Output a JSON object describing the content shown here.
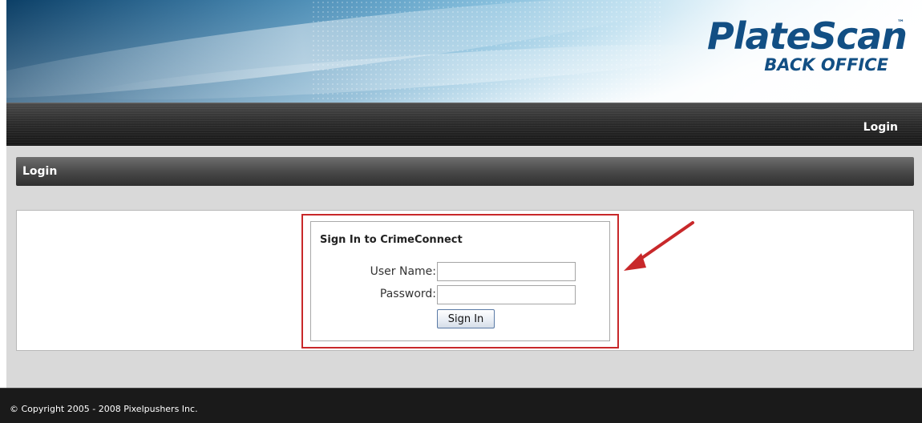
{
  "header": {
    "logo_main": "PlateScan",
    "logo_tm": "™",
    "logo_sub": "BACK OFFICE"
  },
  "nav": {
    "login_label": "Login"
  },
  "section": {
    "title": "Login"
  },
  "login_form": {
    "title": "Sign In to CrimeConnect",
    "username_label": "User Name:",
    "username_value": "",
    "password_label": "Password:",
    "password_value": "",
    "signin_label": "Sign In"
  },
  "annotation": {
    "arrow_color": "#c8282a",
    "highlight_color": "#c8282a"
  },
  "footer": {
    "copyright": "© Copyright 2005 - 2008 Pixelpushers Inc."
  }
}
